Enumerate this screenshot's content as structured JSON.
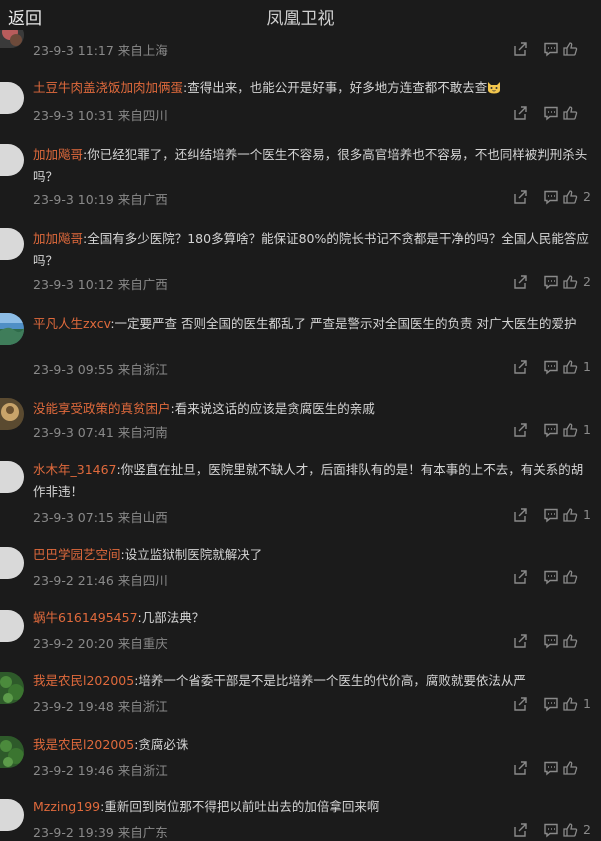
{
  "header": {
    "back_label": "返回",
    "title": "凤凰卫视"
  },
  "comments": [
    {
      "user": "",
      "text": "",
      "time": "23-9-3 11:17 来自上海",
      "likes": ""
    },
    {
      "user": "土豆牛肉盖浇饭加肉加俩蛋",
      "text": ":查得出来，也能公开是好事，好多地方连查都不敢去查",
      "time": "23-9-3 10:31 来自四川",
      "likes": ""
    },
    {
      "user": "加加飚哥",
      "text": ":你已经犯罪了，还纠结培养一个医生不容易，很多高官培养也不容易，不也同样被判刑杀头吗？",
      "time": "23-9-3 10:19 来自广西",
      "likes": "2"
    },
    {
      "user": "加加飚哥",
      "text": ":全国有多少医院？180多算啥？能保证80%的院长书记不贪都是干净的吗？全国人民能答应吗？",
      "time": "23-9-3 10:12 来自广西",
      "likes": "2"
    },
    {
      "user": "平凡人生zxcv",
      "text": ":一定要严查  否则全国的医生都乱了  严查是警示对全国医生的负责  对广大医生的爱护",
      "time": "23-9-3 09:55 来自浙江",
      "likes": "1"
    },
    {
      "user": "没能享受政策的真贫困户",
      "text": ":看来说这话的应该是贪腐医生的亲戚",
      "time": "23-9-3 07:41 来自河南",
      "likes": "1"
    },
    {
      "user": "水木年_31467",
      "text": ":你竖直在扯旦，医院里就不缺人才，后面排队有的是！有本事的上不去，有关系的胡作非违！",
      "time": "23-9-3 07:15 来自山西",
      "likes": "1"
    },
    {
      "user": "巴巴学园艺空间",
      "text": ":设立监狱制医院就解决了",
      "time": "23-9-2 21:46 来自四川",
      "likes": ""
    },
    {
      "user": "蜗牛6161495457",
      "text": ":几部法典？",
      "time": "23-9-2 20:20 来自重庆",
      "likes": ""
    },
    {
      "user": "我是农民l202005",
      "text": ":培养一个省委干部是不是比培养一个医生的代价高，腐败就要依法从严",
      "time": "23-9-2 19:48 来自浙江",
      "likes": "1"
    },
    {
      "user": "我是农民l202005",
      "text": ":贪腐必诛",
      "time": "23-9-2 19:46 来自浙江",
      "likes": ""
    },
    {
      "user": "Mzzing199",
      "text": ":重新回到岗位那不得把以前吐出去的加倍拿回来啊",
      "time": "23-9-2 19:39 来自广东",
      "likes": "2"
    }
  ]
}
